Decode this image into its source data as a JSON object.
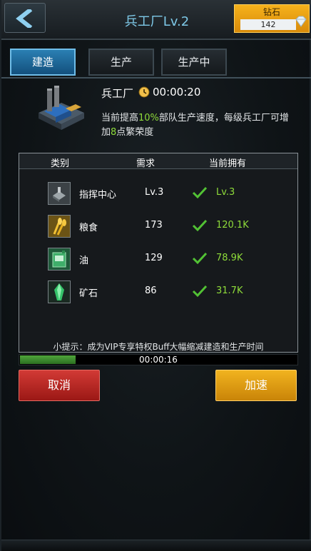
{
  "header": {
    "title": "兵工厂Lv.2",
    "diamond_label": "钻石",
    "diamond_value": "142"
  },
  "tabs": [
    {
      "label": "建造",
      "active": true
    },
    {
      "label": "生产",
      "active": false
    },
    {
      "label": "生产中",
      "active": false
    }
  ],
  "building": {
    "name": "兵工厂",
    "time": "00:00:20",
    "desc_part1": "当前提高",
    "desc_percent": "10%",
    "desc_part2": "部队生产速度，每级兵工厂可增加",
    "desc_points": "8",
    "desc_part3": "点繁荣度"
  },
  "requirements": {
    "headers": {
      "type": "类别",
      "need": "需求",
      "have": "当前拥有"
    },
    "rows": [
      {
        "icon": "command-center-icon",
        "name": "指挥中心",
        "need": "Lv.3",
        "have": "Lv.3"
      },
      {
        "icon": "grain-icon",
        "name": "粮食",
        "need": "173",
        "have": "120.1K"
      },
      {
        "icon": "oil-icon",
        "name": "油",
        "need": "129",
        "have": "78.9K"
      },
      {
        "icon": "ore-icon",
        "name": "矿石",
        "need": "86",
        "have": "31.7K"
      }
    ],
    "tip": "小提示：成为VIP专享特权Buff大幅缩减建造和生产时间"
  },
  "progress": {
    "time_left": "00:00:16",
    "fraction": 0.2
  },
  "buttons": {
    "cancel": "取消",
    "speed_up": "加速"
  },
  "colors": {
    "accent_blue": "#7ec9e8",
    "highlight_green": "#8fdc3a",
    "cancel_red": "#c12a26",
    "speed_gold": "#e3a114"
  }
}
